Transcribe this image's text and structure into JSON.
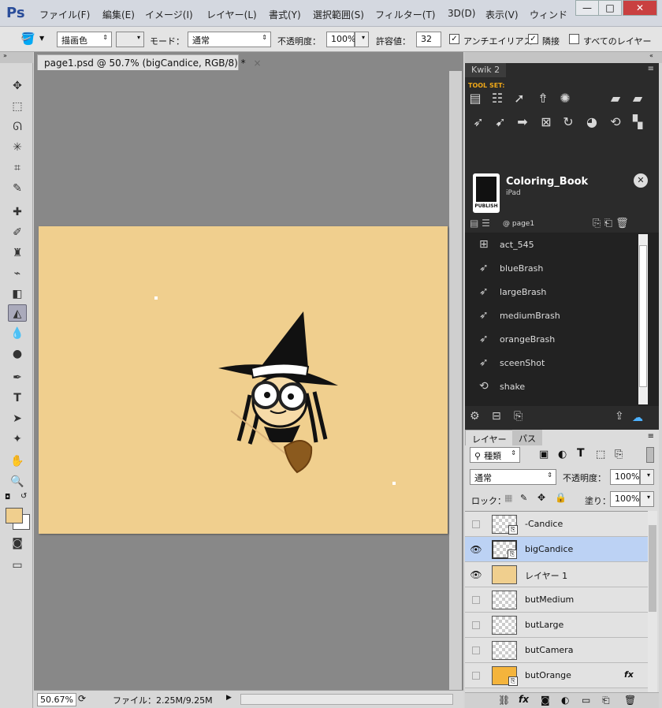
{
  "app": {
    "logo": "Ps"
  },
  "menu": [
    "ファイル(F)",
    "編集(E)",
    "イメージ(I)",
    "レイヤー(L)",
    "書式(Y)",
    "選択範囲(S)",
    "フィルター(T)",
    "3D(D)",
    "表示(V)",
    "ウィンド"
  ],
  "window_controls": {
    "minimize": "—",
    "maximize": "□",
    "close": "✕"
  },
  "options": {
    "fill_source": "描画色",
    "mode_label": "モード：",
    "mode_value": "通常",
    "opacity_label": "不透明度：",
    "opacity_value": "100%",
    "tolerance_label": "許容値：",
    "tolerance_value": "32",
    "antialias_label": "アンチエイリアス",
    "antialias_checked": true,
    "contiguous_label": "隣接",
    "contiguous_checked": true,
    "all_layers_label": "すべてのレイヤー",
    "all_layers_checked": false
  },
  "document": {
    "tab_title": "page1.psd @ 50.7% (bigCandice, RGB/8) *",
    "tab_close": "×",
    "zoom": "50.67%",
    "file_info": "ファイル：2.25M/9.25M",
    "canvas_color": "#f0cf8e"
  },
  "colors": {
    "foreground": "#f0cf8e",
    "background": "#ffffff"
  },
  "kwik": {
    "tab_label": "Kwik 2",
    "toolset_label": "TOOL SET:",
    "project_name": "Coloring_Book",
    "device": "iPad",
    "publish_label": "PUBLISH",
    "page_label": "@ page1",
    "actions": [
      {
        "label": "act_545",
        "icon": "action-icon"
      },
      {
        "label": "blueBrash",
        "icon": "cursor-icon"
      },
      {
        "label": "largeBrash",
        "icon": "cursor-icon"
      },
      {
        "label": "mediumBrash",
        "icon": "cursor-icon"
      },
      {
        "label": "orangeBrash",
        "icon": "cursor-icon"
      },
      {
        "label": "sceenShot",
        "icon": "cursor-icon"
      },
      {
        "label": "shake",
        "icon": "shake-icon"
      }
    ]
  },
  "layers_panel": {
    "tabs": [
      "レイヤー",
      "パス"
    ],
    "filter_kind": "種類",
    "blend_mode": "通常",
    "opacity_label": "不透明度：",
    "opacity_value": "100%",
    "lock_label": "ロック：",
    "fill_label": "塗り：",
    "fill_value": "100%",
    "layers": [
      {
        "name": "-Candice",
        "visible": false,
        "selected": false
      },
      {
        "name": "bigCandice",
        "visible": true,
        "selected": true
      },
      {
        "name": "レイヤー 1",
        "visible": true,
        "selected": false
      },
      {
        "name": "butMedium",
        "visible": false,
        "selected": false
      },
      {
        "name": "butLarge",
        "visible": false,
        "selected": false
      },
      {
        "name": "butCamera",
        "visible": false,
        "selected": false
      },
      {
        "name": "butOrange",
        "visible": false,
        "selected": false,
        "fx": "fx"
      }
    ]
  }
}
